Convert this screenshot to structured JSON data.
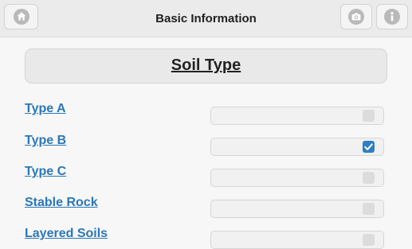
{
  "header": {
    "title": "Basic Information",
    "icons": {
      "home": "home-icon",
      "camera": "camera-icon",
      "info": "info-icon"
    }
  },
  "section": {
    "title": "Soil Type"
  },
  "options": [
    {
      "label": "Type A",
      "checked": false
    },
    {
      "label": "Type B",
      "checked": true
    },
    {
      "label": "Type C",
      "checked": false
    },
    {
      "label": "Stable Rock",
      "checked": false
    },
    {
      "label": "Layered Soils",
      "checked": false
    }
  ],
  "colors": {
    "link": "#2a78b8",
    "checkbox_checked": "#2e7fc4",
    "checkbox_unchecked": "#dcdcdc"
  }
}
